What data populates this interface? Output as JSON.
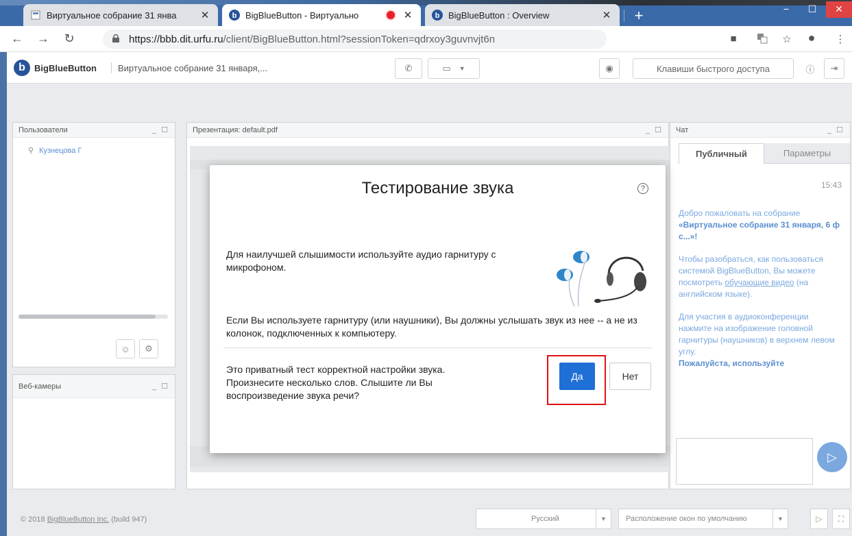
{
  "browser": {
    "tabs": [
      {
        "title": "Виртуальное собрание 31 янва",
        "state": "inactive"
      },
      {
        "title": "BigBlueButton - Виртуально",
        "state": "active"
      },
      {
        "title": "BigBlueButton : Overview",
        "state": "inactive"
      }
    ],
    "url_host": "https://bbb.dit.urfu.ru",
    "url_rest": "/client/BigBlueButton.html?sessionToken=qdrxoy3guvnvjt6n",
    "window_controls": {
      "minimize": "−",
      "maximize": "☐",
      "close": "✕"
    }
  },
  "app": {
    "logo_text": "BigBlueButton",
    "meeting_name": "Виртуальное собрание 31 января,...",
    "shortcuts_label": "Клавиши быстрого доступа",
    "users_panel": {
      "title": "Пользователи",
      "user_name": "Кузнецова Г"
    },
    "webcams_panel": {
      "title": "Веб-камеры"
    },
    "presentation_panel": {
      "title": "Презентация: default.pdf"
    },
    "chat_panel": {
      "title": "Чат",
      "tabs": [
        "Публичный",
        "Параметры"
      ],
      "time": "15:43",
      "welcome_line1": "Добро пожаловать на собрание",
      "welcome_bold": "«Виртуальное собрание 31 января, 6 ф с...»!",
      "help_text_a": "Чтобы разобраться, как пользоваться системой BigBlueButton, Вы можете посмотреть ",
      "help_link": "обучающие видео",
      "help_text_b": " (на английском языке).",
      "join_text": "Для участия в аудиоконференции нажмите на изображение головной гарнитуры (наушников) в верхнем левом углу.",
      "please_text": "Пожалуйста, используйте"
    },
    "footer": {
      "copyright_prefix": "© 2018 ",
      "copyright_link": "BigBlueButton Inc.",
      "copyright_suffix": " (build 947)",
      "language": "Русский",
      "layout": "Расположение окон по умолчанию"
    }
  },
  "modal": {
    "title": "Тестирование звука",
    "help": "?",
    "p1": "Для наилучшей слышимости используйте аудио гарнитуру с микрофоном.",
    "p2": "Если Вы используете гарнитуру (или наушники), Вы должны услышать звук из нее -- а не из колонок, подключенных к компьютеру.",
    "p3": "Это приватный тест корректной настройки звука. Произнесите несколько слов. Слышите ли Вы воспроизведение звука речи?",
    "yes_label": "Да",
    "no_label": "Нет"
  },
  "colors": {
    "accent": "#1e6fd6",
    "highlight": "#e01010",
    "chat_text": "#7aa8df"
  }
}
